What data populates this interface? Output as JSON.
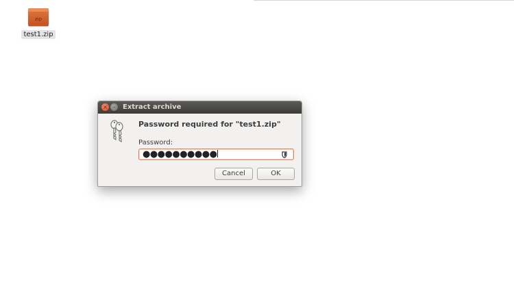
{
  "desktop": {
    "icon_label": "test1.zip",
    "icon_badge": "zip",
    "icon": "zip-archive-icon"
  },
  "dialog": {
    "title": "Extract archive",
    "heading": "Password required for \"test1.zip\"",
    "password_label": "Password:",
    "password_masked": "●●●●●●●●●●",
    "icons": [
      "close-icon",
      "minimize-icon",
      "keys-icon",
      "reveal-password-icon"
    ],
    "cancel_label": "Cancel",
    "ok_label": "OK",
    "accent_color": "#e97d54"
  }
}
